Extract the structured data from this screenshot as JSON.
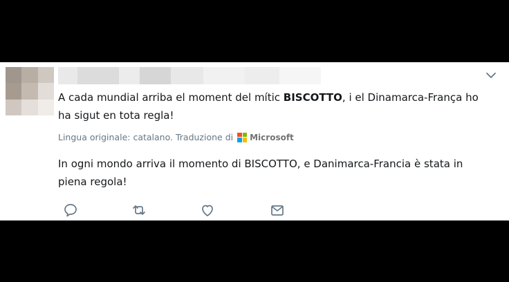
{
  "tweet": {
    "text_before": "A cada mundial arriba el moment del mític ",
    "text_bold": "BISCOTTO",
    "text_after": ", i el Dinamarca-França ho ha sigut en tota regla!",
    "translation_note": "Lingua originale: catalano. Traduzione di",
    "translator_brand": "Microsoft",
    "translated_text": "In ogni mondo arriva il momento di BISCOTTO, e Danimarca-Francia è stata in piena regola!"
  },
  "icons": {
    "menu": "chevron-down-icon",
    "reply": "reply-icon",
    "retweet": "retweet-icon",
    "like": "heart-icon",
    "message": "envelope-icon",
    "translator": "microsoft-logo-icon"
  },
  "colors": {
    "text": "#14171a",
    "secondary": "#657786",
    "icon": "#657786",
    "ms_red": "#f25022",
    "ms_green": "#7fba00",
    "ms_blue": "#00a4ef",
    "ms_yellow": "#ffb900"
  }
}
